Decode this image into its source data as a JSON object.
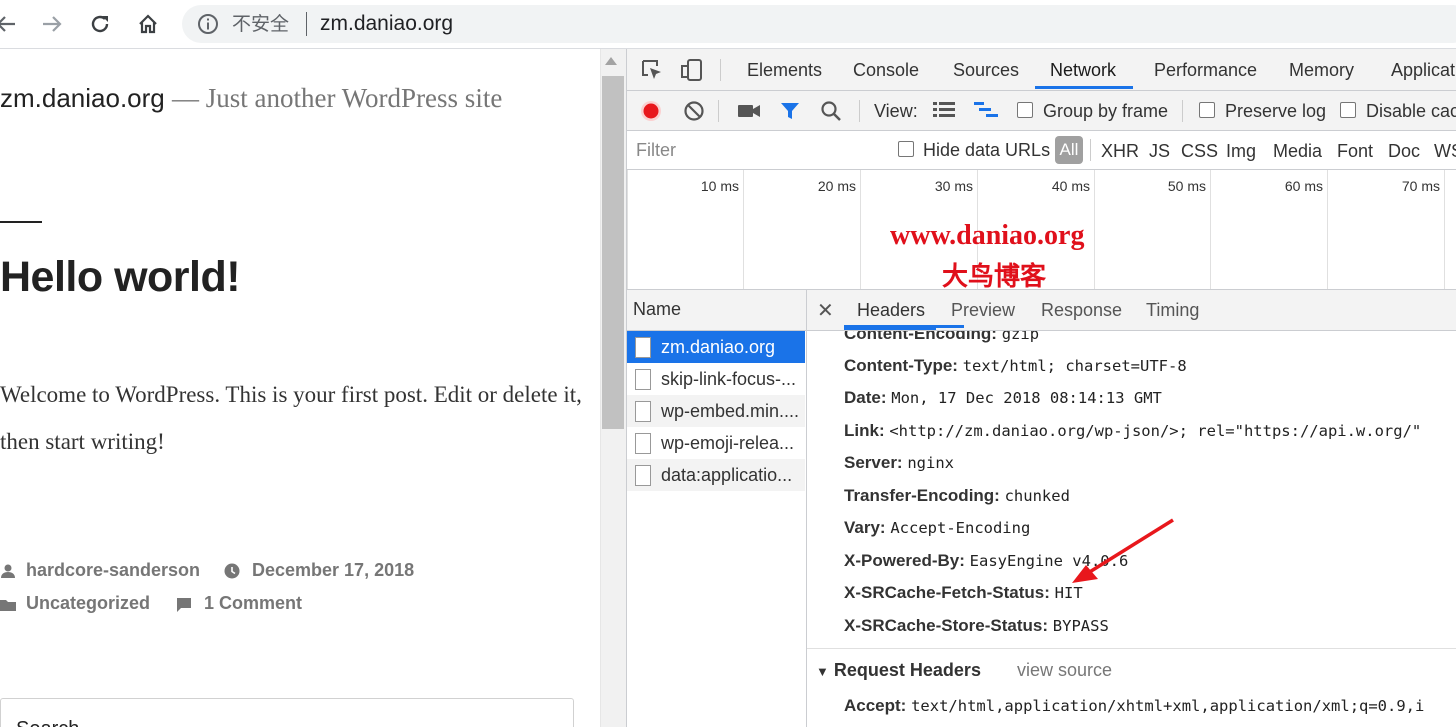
{
  "omnibox": {
    "security": "不安全",
    "url": "zm.daniao.org"
  },
  "page": {
    "site_title": "zm.daniao.org",
    "site_separator": "—",
    "site_description": "Just another WordPress site",
    "post_title": "Hello world!",
    "post_body": "Welcome to WordPress. This is your first post. Edit or delete it, then start writing!",
    "author": "hardcore-sanderson",
    "date": "December 17, 2018",
    "category": "Uncategorized",
    "comments": "1 Comment",
    "search_label": "Search"
  },
  "devtools": {
    "tabs": [
      "Elements",
      "Console",
      "Sources",
      "Network",
      "Performance",
      "Memory",
      "Applicat"
    ],
    "active_tab": "Network",
    "toolbar": {
      "view_label": "View:",
      "group_by_frame": "Group by frame",
      "preserve_log": "Preserve log",
      "disable_cache": "Disable cac"
    },
    "filter": {
      "placeholder": "Filter",
      "hide_data_urls": "Hide data URLs",
      "all": "All",
      "types": [
        "XHR",
        "JS",
        "CSS",
        "Img",
        "Media",
        "Font",
        "Doc",
        "WS"
      ]
    },
    "timeline_ticks": [
      "10 ms",
      "20 ms",
      "30 ms",
      "40 ms",
      "50 ms",
      "60 ms",
      "70 ms"
    ],
    "watermark": {
      "line1": "www.daniao.org",
      "line2": "大鸟博客"
    },
    "name_header": "Name",
    "requests": [
      "zm.daniao.org",
      "skip-link-focus-...",
      "wp-embed.min....",
      "wp-emoji-relea...",
      "data:applicatio..."
    ],
    "detail_tabs": [
      "Headers",
      "Preview",
      "Response",
      "Timing"
    ],
    "headers": [
      {
        "key": "Content-Encoding:",
        "value": "gzip"
      },
      {
        "key": "Content-Type:",
        "value": "text/html; charset=UTF-8"
      },
      {
        "key": "Date:",
        "value": "Mon, 17 Dec 2018 08:14:13 GMT"
      },
      {
        "key": "Link:",
        "value": "<http://zm.daniao.org/wp-json/>; rel=\"https://api.w.org/\""
      },
      {
        "key": "Server:",
        "value": "nginx"
      },
      {
        "key": "Transfer-Encoding:",
        "value": "chunked"
      },
      {
        "key": "Vary:",
        "value": "Accept-Encoding"
      },
      {
        "key": "X-Powered-By:",
        "value": "EasyEngine v4.0.6"
      },
      {
        "key": "X-SRCache-Fetch-Status:",
        "value": "HIT"
      },
      {
        "key": "X-SRCache-Store-Status:",
        "value": "BYPASS"
      }
    ],
    "request_headers_label": "Request Headers",
    "view_source": "view source",
    "accept": {
      "key": "Accept:",
      "value": "text/html,application/xhtml+xml,application/xml;q=0.9,i"
    }
  },
  "colors": {
    "accent": "#1a73e8",
    "record": "#e8171c",
    "watermark": "#e0101b",
    "arrow": "#e8171c"
  }
}
